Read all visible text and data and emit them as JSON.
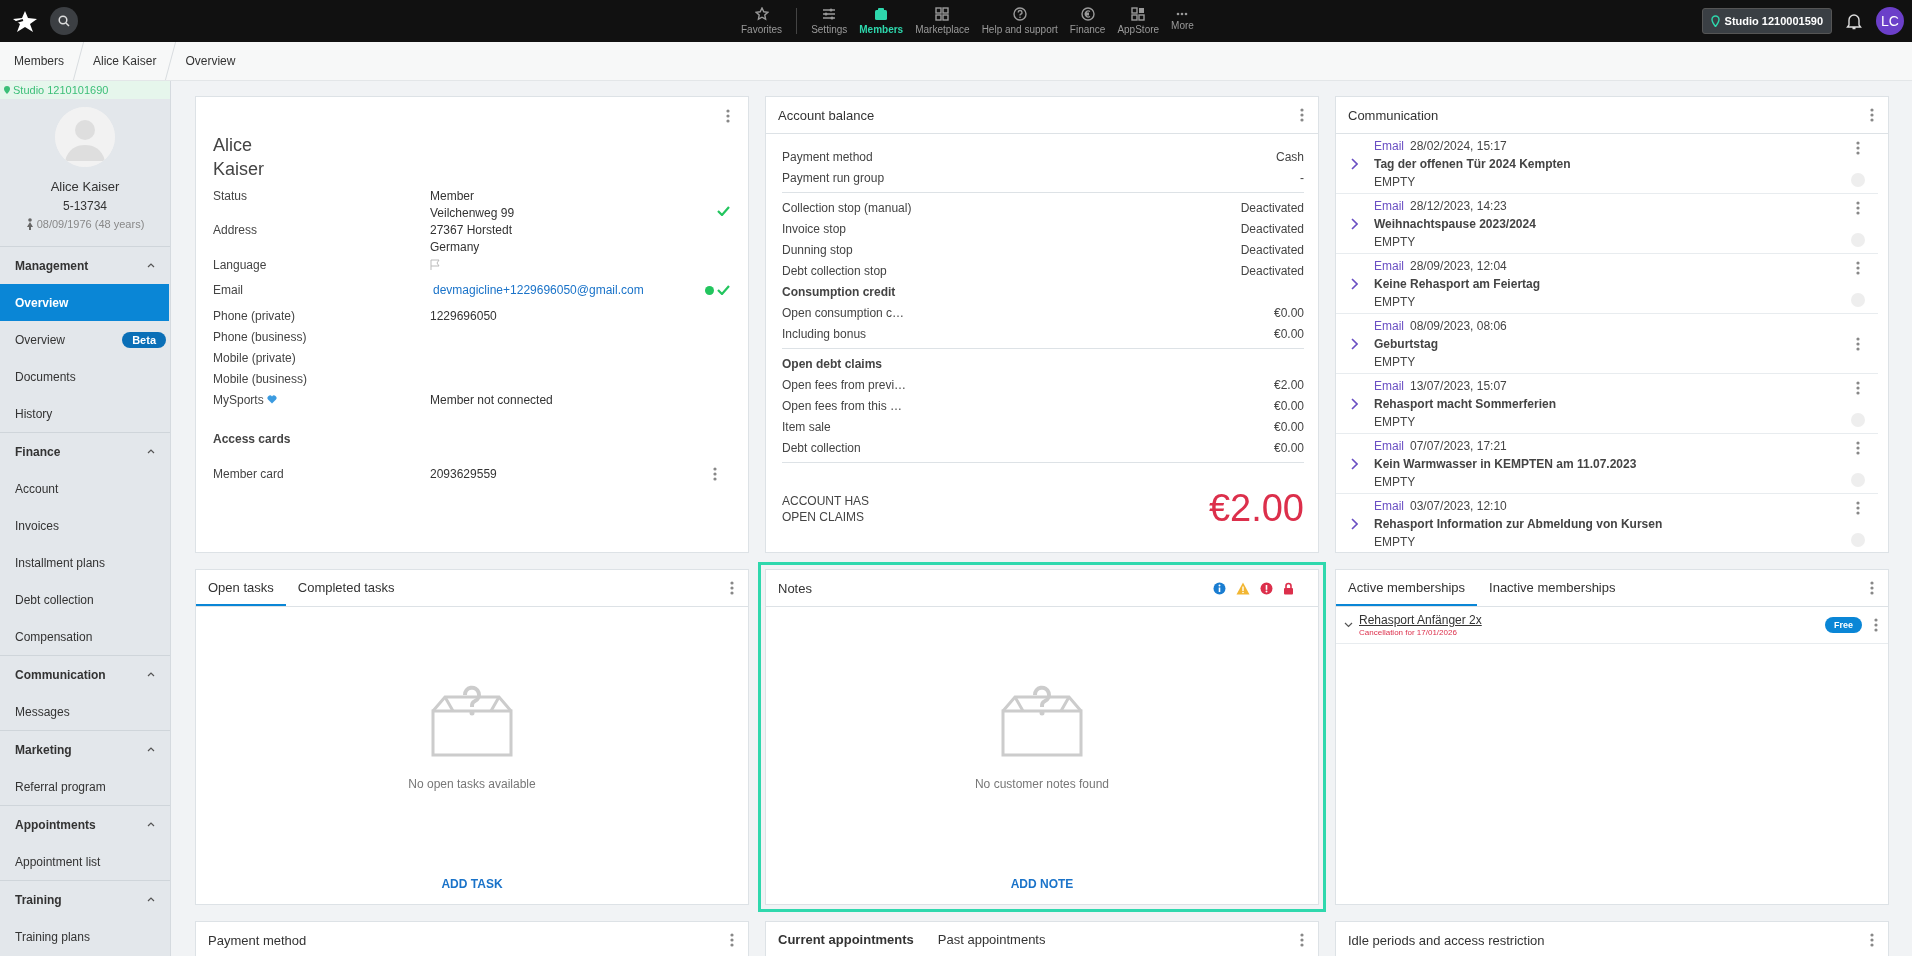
{
  "topbar": {
    "nav": [
      {
        "label": "Favorites",
        "selected": false
      },
      {
        "label": "Settings",
        "selected": false
      },
      {
        "label": "Members",
        "selected": true
      },
      {
        "label": "Marketplace",
        "selected": false
      },
      {
        "label": "Help and support",
        "selected": false
      },
      {
        "label": "Finance",
        "selected": false
      },
      {
        "label": "AppStore",
        "selected": false
      },
      {
        "label": "More",
        "selected": false
      }
    ],
    "studio": "Studio 1210001590",
    "avatar": "LC"
  },
  "breadcrumbs": [
    "Members",
    "Alice Kaiser",
    "Overview"
  ],
  "sidebar": {
    "studio": "Studio 1210101690",
    "name": "Alice Kaiser",
    "member_id": "5-13734",
    "birth": "08/09/1976 (48 years)",
    "sections": [
      {
        "title": "Management",
        "expanded": true,
        "items": [
          {
            "label": "Overview",
            "selected": true
          },
          {
            "label": "Overview",
            "selected": false,
            "badge": "Beta"
          },
          {
            "label": "Documents",
            "selected": false
          },
          {
            "label": "History",
            "selected": false
          }
        ]
      },
      {
        "title": "Finance",
        "expanded": true,
        "items": [
          {
            "label": "Account",
            "selected": false
          },
          {
            "label": "Invoices",
            "selected": false
          },
          {
            "label": "Installment plans",
            "selected": false
          },
          {
            "label": "Debt collection",
            "selected": false
          },
          {
            "label": "Compensation",
            "selected": false
          }
        ]
      },
      {
        "title": "Communication",
        "expanded": true,
        "items": [
          {
            "label": "Messages",
            "selected": false
          }
        ]
      },
      {
        "title": "Marketing",
        "expanded": true,
        "items": [
          {
            "label": "Referral program",
            "selected": false
          }
        ]
      },
      {
        "title": "Appointments",
        "expanded": true,
        "items": [
          {
            "label": "Appointment list",
            "selected": false
          }
        ]
      },
      {
        "title": "Training",
        "expanded": true,
        "items": [
          {
            "label": "Training plans",
            "selected": false
          }
        ]
      }
    ]
  },
  "member": {
    "first_name": "Alice",
    "last_name": "Kaiser",
    "rows": [
      {
        "kind": "field",
        "label": "Status",
        "value": "Member"
      },
      {
        "kind": "address",
        "label": "Address",
        "lines": [
          "Veilchenweg 99",
          "27367 Horstedt",
          "Germany"
        ],
        "verified": true
      },
      {
        "kind": "language",
        "label": "Language"
      },
      {
        "kind": "email",
        "label": "Email",
        "value": "devmagicline+1229696050@gmail.com",
        "verified": true
      },
      {
        "kind": "field",
        "label": "Phone (private)",
        "value": "1229696050"
      },
      {
        "kind": "field",
        "label": "Phone (business)"
      },
      {
        "kind": "field",
        "label": "Mobile (private)"
      },
      {
        "kind": "field",
        "label": "Mobile (business)"
      },
      {
        "kind": "mysports",
        "label": "MySports",
        "value": "Member not connected"
      },
      {
        "kind": "section",
        "label": "Access cards"
      },
      {
        "kind": "card",
        "label": "Member card",
        "value": "2093629559"
      }
    ]
  },
  "account": {
    "title": "Account balance",
    "groups": [
      [
        {
          "kind": "row",
          "label": "Payment method",
          "value": "Cash"
        },
        {
          "kind": "row",
          "label": "Payment run group",
          "value": "-"
        }
      ],
      [
        {
          "kind": "row",
          "label": "Collection stop (manual)",
          "value": "Deactivated"
        },
        {
          "kind": "row",
          "label": "Invoice stop",
          "value": "Deactivated"
        },
        {
          "kind": "row",
          "label": "Dunning stop",
          "value": "Deactivated"
        },
        {
          "kind": "row",
          "label": "Debt collection stop",
          "value": "Deactivated"
        },
        {
          "kind": "heading",
          "label": "Consumption credit"
        },
        {
          "kind": "row",
          "label": "Open consumption c…",
          "value": "€0.00"
        },
        {
          "kind": "row",
          "label": "Including bonus",
          "value": "€0.00"
        }
      ],
      [
        {
          "kind": "heading",
          "label": "Open debt claims"
        },
        {
          "kind": "row",
          "label": "Open fees from previ…",
          "value": "€2.00"
        },
        {
          "kind": "row",
          "label": "Open fees from this …",
          "value": "€0.00"
        },
        {
          "kind": "row",
          "label": "Item sale",
          "value": "€0.00"
        },
        {
          "kind": "row",
          "label": "Debt collection",
          "value": "€0.00"
        }
      ]
    ],
    "total_label": [
      "ACCOUNT HAS",
      "OPEN CLAIMS"
    ],
    "total": "€2.00"
  },
  "communication": {
    "title": "Communication",
    "items": [
      {
        "channel": "Email",
        "date": "28/02/2024, 15:17",
        "subject": "Tag der offenen Tür 2024 Kempten",
        "status": "EMPTY",
        "avatar": true
      },
      {
        "channel": "Email",
        "date": "28/12/2023, 14:23",
        "subject": "Weihnachtspause 2023/2024",
        "status": "EMPTY",
        "avatar": true
      },
      {
        "channel": "Email",
        "date": "28/09/2023, 12:04",
        "subject": "Keine Rehasport am Feiertag",
        "status": "EMPTY",
        "avatar": true
      },
      {
        "channel": "Email",
        "date": "08/09/2023, 08:06",
        "subject": "Geburtstag",
        "status": "EMPTY",
        "avatar": false
      },
      {
        "channel": "Email",
        "date": "13/07/2023, 15:07",
        "subject": "Rehasport macht Sommerferien",
        "status": "EMPTY",
        "avatar": true
      },
      {
        "channel": "Email",
        "date": "07/07/2023, 17:21",
        "subject": "Kein Warmwasser in KEMPTEN am 11.07.2023",
        "status": "EMPTY",
        "avatar": true
      },
      {
        "channel": "Email",
        "date": "03/07/2023, 12:10",
        "subject": "Rehasport Information zur Abmeldung von Kursen",
        "status": "EMPTY",
        "avatar": true
      }
    ]
  },
  "tasks": {
    "tabs": [
      {
        "label": "Open tasks",
        "selected": true
      },
      {
        "label": "Completed tasks",
        "selected": false
      }
    ],
    "empty": "No open tasks available",
    "action": "ADD TASK"
  },
  "notes": {
    "title": "Notes",
    "highlighted": true,
    "empty": "No customer notes found",
    "action": "ADD NOTE"
  },
  "memberships": {
    "tabs": [
      {
        "label": "Active memberships",
        "selected": true
      },
      {
        "label": "Inactive memberships",
        "selected": false
      }
    ],
    "items": [
      {
        "name": "Rehasport Anfänger 2x",
        "note": "Cancellation for 17/01/2026",
        "badge": "Free"
      }
    ]
  },
  "payment_method": {
    "title": "Payment method"
  },
  "appointments": {
    "tabs": [
      {
        "label": "Current appointments",
        "selected": true
      },
      {
        "label": "Past appointments",
        "selected": false
      }
    ]
  },
  "idle": {
    "title": "Idle periods and access restriction"
  }
}
